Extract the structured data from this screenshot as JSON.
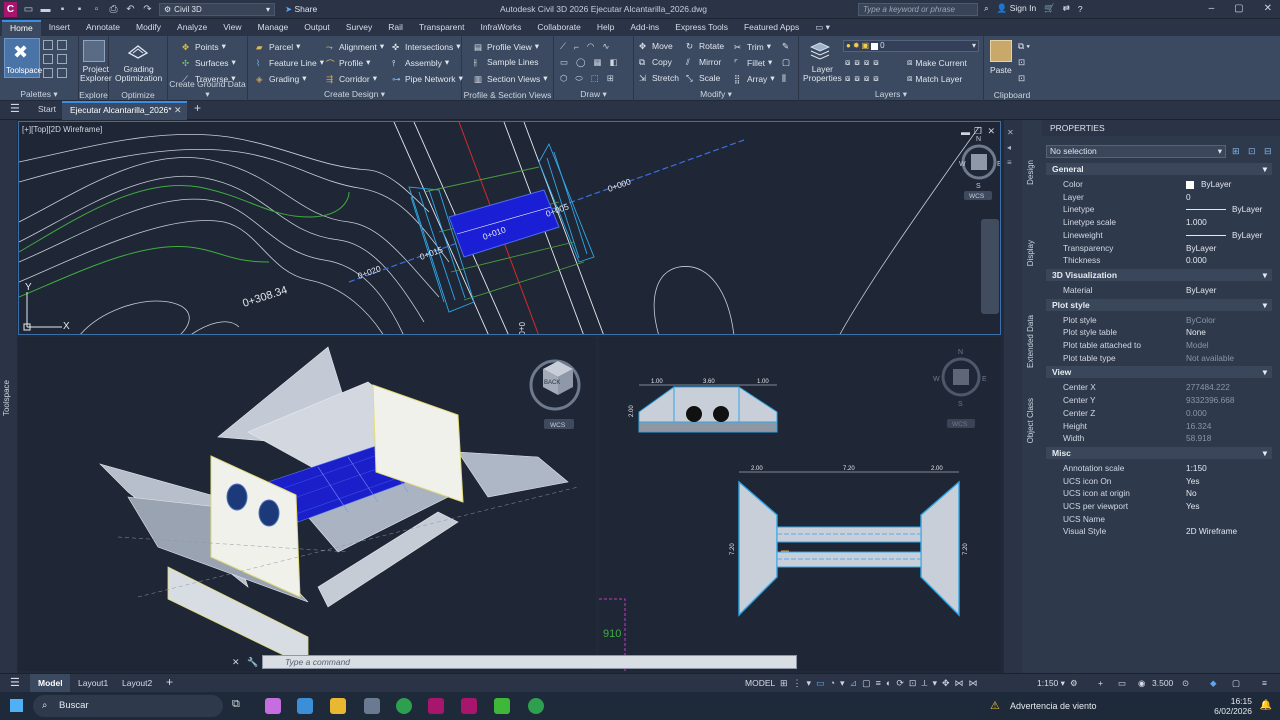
{
  "app": {
    "workspace": "Civil 3D",
    "share_label": "Share",
    "window_title": "Autodesk Civil 3D 2026   Ejecutar Alcantarilla_2026.dwg",
    "search_placeholder": "Type a keyword or phrase",
    "sign_in": "Sign In"
  },
  "menu_tabs": [
    "Home",
    "Insert",
    "Annotate",
    "Modify",
    "Analyze",
    "View",
    "Manage",
    "Output",
    "Survey",
    "Rail",
    "Transparent",
    "InfraWorks",
    "Collaborate",
    "Help",
    "Add-ins",
    "Express Tools",
    "Featured Apps"
  ],
  "ribbon": {
    "panels": {
      "palettes": "Palettes",
      "explore": "Explore",
      "optimize": "Optimize",
      "ground": "Create Ground Data",
      "design": "Create Design",
      "profile": "Profile & Section Views",
      "draw": "Draw",
      "modify": "Modify",
      "layers": "Layers",
      "clipboard": "Clipboard"
    },
    "toolspace": "Toolspace",
    "project_explorer": [
      "Project",
      "Explorer"
    ],
    "grading_optimization": [
      "Grading",
      "Optimization"
    ],
    "ground_items": [
      "Points",
      "Surfaces",
      "Traverse"
    ],
    "design_col1": [
      "Parcel",
      "Feature Line",
      "Grading"
    ],
    "design_col2": [
      "Alignment",
      "Profile",
      "Corridor"
    ],
    "design_col3": [
      "Intersections",
      "Assembly",
      "Pipe Network"
    ],
    "profile_items": [
      "Profile View",
      "Sample Lines",
      "Section Views"
    ],
    "modify_col1": [
      "Move",
      "Copy",
      "Stretch"
    ],
    "modify_col2": [
      "Rotate",
      "Mirror",
      "Scale"
    ],
    "modify_col3": [
      "Trim",
      "Fillet",
      "Array"
    ],
    "layer_properties": [
      "Layer",
      "Properties"
    ],
    "layer_value": "0",
    "make_current": "Make Current",
    "match_layer": "Match Layer",
    "paste": "Paste"
  },
  "doc_tabs": {
    "start": "Start",
    "active": "Ejecutar Alcantarilla_2026*"
  },
  "viewports": {
    "top_label": "[+][Top][2D Wireframe]",
    "stations": [
      "0+000",
      "0+005",
      "0+010",
      "0+015",
      "0+020",
      "0+308.34"
    ],
    "axis_y": "Y",
    "axis_x": "X",
    "wcs": "WCS",
    "compass": {
      "n": "N",
      "s": "S",
      "e": "E",
      "w": "W"
    },
    "cube_label": "BACK",
    "section_dims": {
      "left": "1.00",
      "mid": "3.60",
      "right": "1.00",
      "height": "2.00"
    },
    "plan_dims": {
      "left": "2.00",
      "mid": "7.20",
      "right": "2.00",
      "side": "7.20"
    },
    "elevation_mark": "910"
  },
  "toolspace_label": "Toolspace",
  "side_tabs": [
    "Design",
    "Display",
    "Extended Data",
    "Object Class"
  ],
  "properties": {
    "title": "PROPERTIES",
    "selection": "No selection",
    "sections": [
      {
        "name": "General",
        "rows": [
          [
            "Color",
            "ByLayer"
          ],
          [
            "Layer",
            "0"
          ],
          [
            "Linetype",
            "ByLayer"
          ],
          [
            "Linetype scale",
            "1.000"
          ],
          [
            "Lineweight",
            "ByLayer"
          ],
          [
            "Transparency",
            "ByLayer"
          ],
          [
            "Thickness",
            "0.000"
          ]
        ]
      },
      {
        "name": "3D Visualization",
        "rows": [
          [
            "Material",
            "ByLayer"
          ]
        ]
      },
      {
        "name": "Plot style",
        "rows": [
          [
            "Plot style",
            "ByColor"
          ],
          [
            "Plot style table",
            "None"
          ],
          [
            "Plot table attached to",
            "Model"
          ],
          [
            "Plot table type",
            "Not available"
          ]
        ]
      },
      {
        "name": "View",
        "rows": [
          [
            "Center X",
            "277484.222"
          ],
          [
            "Center Y",
            "9332396.668"
          ],
          [
            "Center Z",
            "0.000"
          ],
          [
            "Height",
            "16.324"
          ],
          [
            "Width",
            "58.918"
          ]
        ]
      },
      {
        "name": "Misc",
        "rows": [
          [
            "Annotation scale",
            "1:150"
          ],
          [
            "UCS icon On",
            "Yes"
          ],
          [
            "UCS icon at origin",
            "No"
          ],
          [
            "UCS per viewport",
            "Yes"
          ],
          [
            "UCS Name",
            ""
          ],
          [
            "Visual Style",
            "2D Wireframe"
          ]
        ]
      }
    ]
  },
  "command_placeholder": "Type  a  command",
  "status": {
    "tabs": [
      "Model",
      "Layout1",
      "Layout2"
    ],
    "model_label": "MODEL",
    "scale": "1:150",
    "value": "3.500"
  },
  "taskbar": {
    "search": "Buscar",
    "notice": "Advertencia de viento",
    "time": "16:15",
    "date": "6/02/2026"
  },
  "colors": {
    "accent": "#3b8ee6",
    "brand": "#a8156d",
    "culvert": "#1a1fd6",
    "linework": "#d9dde6"
  }
}
